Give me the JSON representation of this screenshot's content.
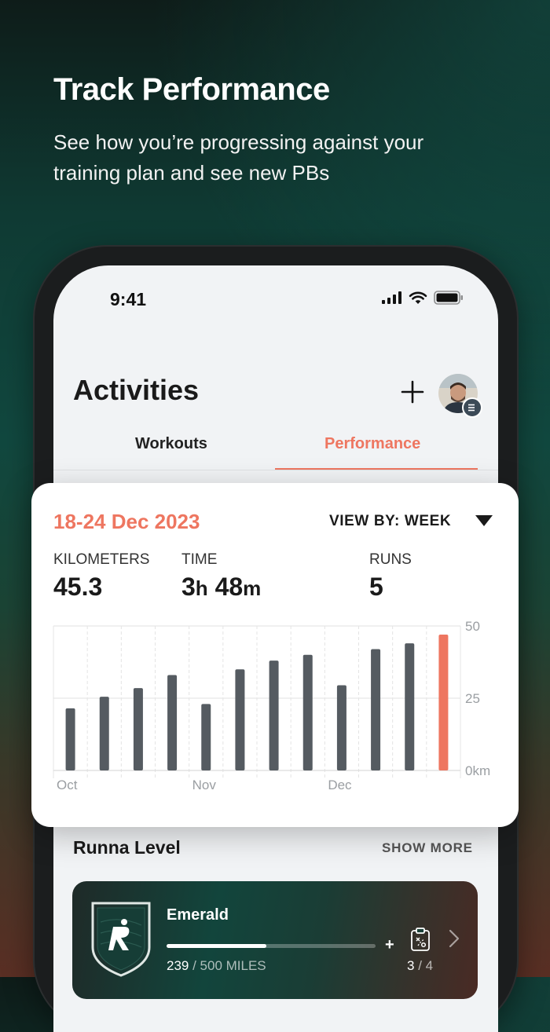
{
  "hero": {
    "title": "Track Performance",
    "subtitle": "See how you’re progressing against your training plan and see new PBs"
  },
  "status_bar": {
    "time": "9:41"
  },
  "header": {
    "title": "Activities"
  },
  "tabs": [
    {
      "label": "Workouts",
      "active": false
    },
    {
      "label": "Performance",
      "active": true
    }
  ],
  "performance_card": {
    "date_range": "18-24 Dec 2023",
    "view_by": "VIEW BY: WEEK",
    "stats": {
      "kilometers_label": "KILOMETERS",
      "kilometers_value": "45.3",
      "time_label": "TIME",
      "time_hours": "3",
      "time_hours_unit": "h",
      "time_minutes": "48",
      "time_minutes_unit": "m",
      "runs_label": "RUNS",
      "runs_value": "5"
    }
  },
  "chart_data": {
    "type": "bar",
    "x_labels": [
      "Oct",
      "Nov",
      "Dec"
    ],
    "y_tick_labels": [
      "50",
      "25",
      "0km"
    ],
    "ylim": [
      0,
      50
    ],
    "values": [
      21.5,
      25.5,
      28.5,
      33,
      23,
      35,
      38,
      40,
      29.5,
      42,
      44,
      47
    ],
    "highlight_index": 11,
    "bar_color": "#555b61",
    "highlight_color": "#ee7660",
    "grid": true
  },
  "runna_level": {
    "title": "Runna Level",
    "show_more": "SHOW MORE",
    "level_name": "Emerald",
    "miles_current": "239",
    "miles_total": " / 500 MILES",
    "progress": 0.478,
    "workouts_done": "3",
    "workouts_total": " / 4"
  },
  "colors": {
    "accent": "#ee7660",
    "bar": "#555b61"
  },
  "icons": {
    "signal": "signal-icon",
    "wifi": "wifi-icon",
    "battery": "battery-icon",
    "add": "plus-icon",
    "dropdown": "triangle-down-icon",
    "clipboard": "clipboard-icon",
    "chevron": "chevron-right-icon"
  }
}
